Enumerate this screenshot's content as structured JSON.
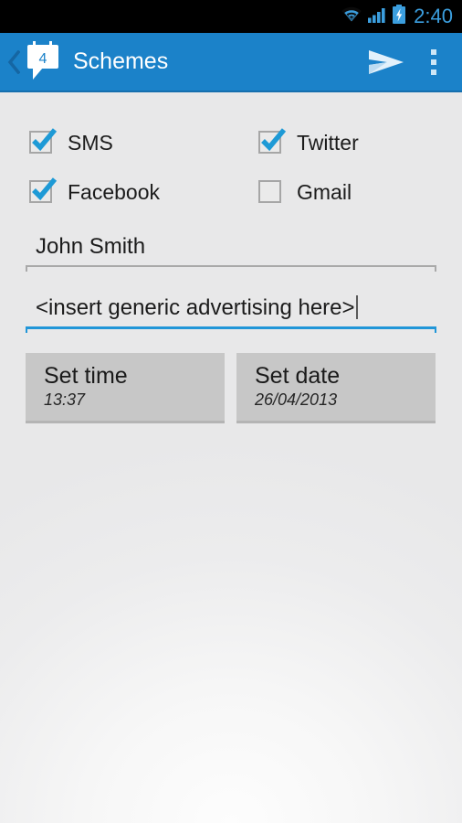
{
  "status_bar": {
    "time": "2:40",
    "icons": [
      {
        "name": "wifi-icon",
        "label": "wifi"
      },
      {
        "name": "cellular-signal-icon",
        "label": "signal"
      },
      {
        "name": "battery-charging-icon",
        "label": "battery charging"
      }
    ],
    "time_color": "#3b9ede",
    "background": "#000000"
  },
  "action_bar": {
    "background": "#1b82c9",
    "title": "Schemes",
    "app_icon_badge": "4",
    "back_icon": "back-chevron-icon",
    "app_icon": "speech-bubble-calendar-icon",
    "send_icon": "send-icon",
    "overflow_icon": "overflow-menu-icon"
  },
  "form": {
    "checkboxes": [
      {
        "label": "SMS",
        "checked": true
      },
      {
        "label": "Twitter",
        "checked": true
      },
      {
        "label": "Facebook",
        "checked": true
      },
      {
        "label": "Gmail",
        "checked": false
      }
    ],
    "name_field": {
      "value": "John Smith",
      "placeholder": "Name",
      "focused": false
    },
    "message_field": {
      "value": "<insert generic advertising here>",
      "placeholder": "Message",
      "focused": true
    },
    "buttons": [
      {
        "title": "Set time",
        "value": "13:37",
        "name": "set-time-button"
      },
      {
        "title": "Set date",
        "value": "26/04/2013",
        "name": "set-date-button"
      }
    ]
  },
  "theme": {
    "accent": "#1b82c9",
    "checkbox_check": "#1e9ad6",
    "button_bg": "#c7c7c7",
    "page_bg": "#ececec"
  }
}
